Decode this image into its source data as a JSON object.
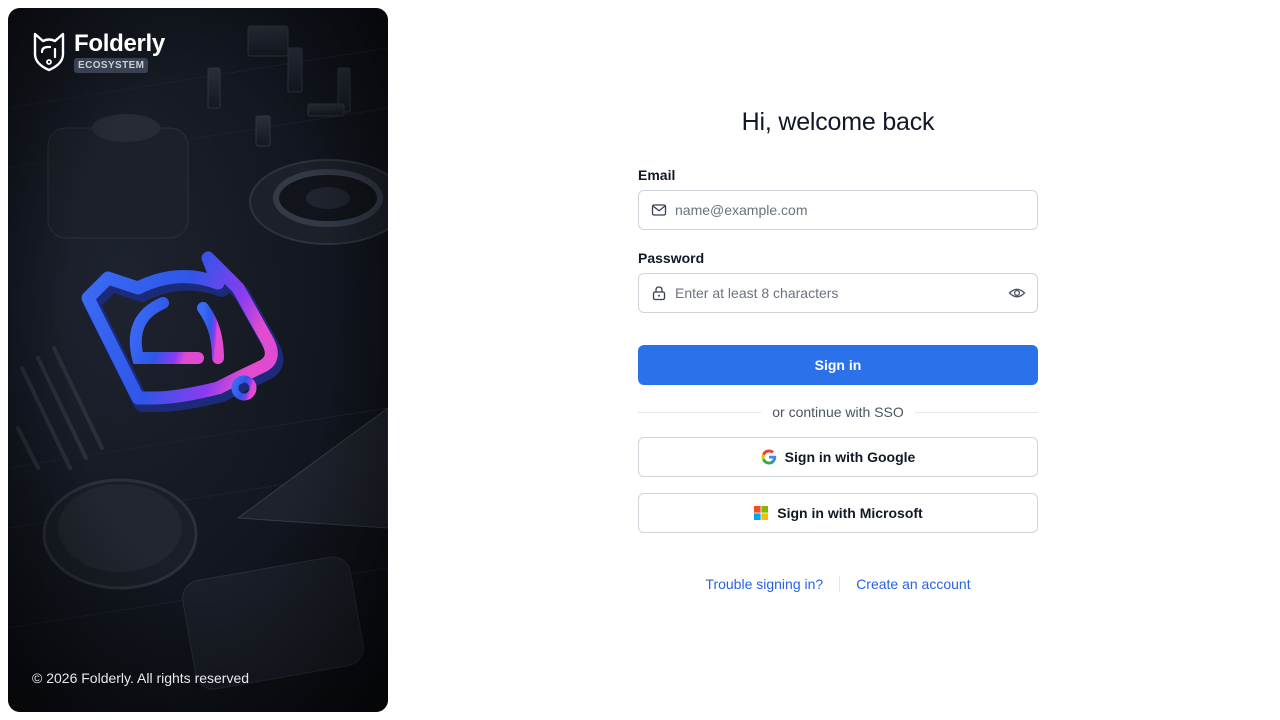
{
  "brand": {
    "name": "Folderly",
    "tag": "ECOSYSTEM",
    "logo_icon": "folderly-fox-icon"
  },
  "hero": {
    "copyright": "© 2026 Folderly. All rights reserved"
  },
  "form": {
    "title": "Hi, welcome back",
    "email": {
      "label": "Email",
      "placeholder": "name@example.com",
      "value": "",
      "icon": "mail-icon"
    },
    "password": {
      "label": "Password",
      "placeholder": "Enter at least 8 characters",
      "value": "",
      "icon": "lock-icon",
      "toggle_icon": "eye-icon"
    },
    "submit_label": "Sign in",
    "divider_text": "or continue with SSO",
    "sso": {
      "google_label": "Sign in with Google",
      "microsoft_label": "Sign in with Microsoft"
    }
  },
  "links": {
    "trouble": "Trouble signing in?",
    "create_account": "Create an account"
  },
  "colors": {
    "primary": "#2b71ea",
    "link": "#2563eb",
    "hero_bg": "#141821"
  }
}
